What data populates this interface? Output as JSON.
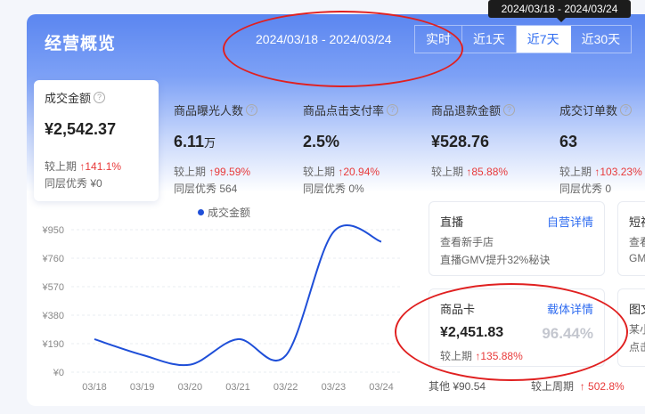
{
  "header": {
    "title": "经营概览",
    "date_range": "2024/03/18 - 2024/03/24",
    "tabs": [
      "实时",
      "近1天",
      "近7天",
      "近30天"
    ],
    "active_tab": "近7天",
    "tooltip": "2024/03/18 - 2024/03/24"
  },
  "metrics": [
    {
      "label": "成交金额",
      "value": "¥2,542.37",
      "unit": "",
      "cmp_label": "较上期",
      "cmp_value": "141.1%",
      "peer": "同层优秀 ¥0"
    },
    {
      "label": "商品曝光人数",
      "value": "6.11",
      "unit": "万",
      "cmp_label": "较上期",
      "cmp_value": "99.59%",
      "peer": "同层优秀 564"
    },
    {
      "label": "商品点击支付率",
      "value": "2.5%",
      "unit": "",
      "cmp_label": "较上期",
      "cmp_value": "20.94%",
      "peer": "同层优秀 0%"
    },
    {
      "label": "商品退款金额",
      "value": "¥528.76",
      "unit": "",
      "cmp_label": "较上期",
      "cmp_value": "85.88%",
      "peer": ""
    },
    {
      "label": "成交订单数",
      "value": "63",
      "unit": "",
      "cmp_label": "较上期",
      "cmp_value": "103.23%",
      "peer": "同层优秀 0"
    }
  ],
  "chart_data": {
    "type": "line",
    "title": "",
    "legend": "成交金额",
    "categories": [
      "03/18",
      "03/19",
      "03/20",
      "03/21",
      "03/22",
      "03/23",
      "03/24"
    ],
    "series": [
      {
        "name": "成交金额",
        "values": [
          220,
          115,
          50,
          220,
          110,
          935,
          870
        ]
      }
    ],
    "yticks": [
      "¥950",
      "¥760",
      "¥570",
      "¥380",
      "¥190",
      "¥0"
    ],
    "ylim": [
      0,
      950
    ],
    "grid": true,
    "line_color": "#1f4fd8"
  },
  "cards": {
    "live": {
      "title": "直播",
      "link": "自营详情",
      "line1": "查看新手店",
      "line2": "直播GMV提升32%秘诀"
    },
    "short": {
      "title": "短视",
      "line1": "查看",
      "line2": "GMV"
    },
    "product_card": {
      "title": "商品卡",
      "link": "载体详情",
      "value": "¥2,451.83",
      "percent": "96.44%",
      "cmp_label": "较上期",
      "cmp_value": "135.88%"
    },
    "graphic": {
      "title": "图文",
      "line1": "某小",
      "line2": "点击"
    }
  },
  "bottom": {
    "other": "其他 ¥90.54",
    "cmp_label": "较上周期",
    "cmp_value": "502.8%"
  },
  "colors": {
    "accent": "#2f6cf0",
    "up": "#e83a3a",
    "annotation": "#e02020"
  }
}
